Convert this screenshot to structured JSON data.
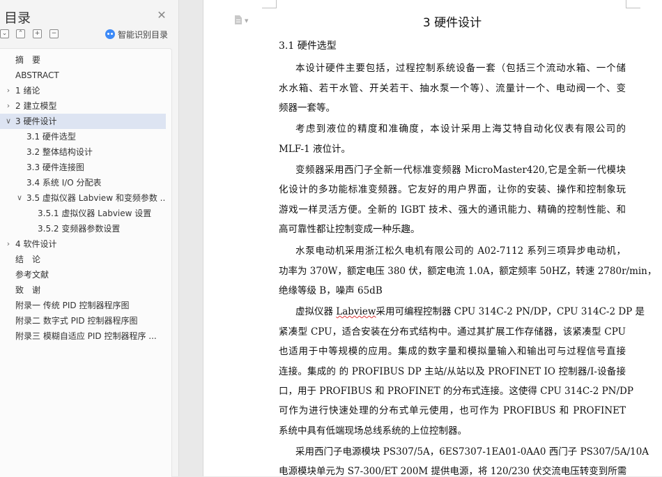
{
  "sidebar": {
    "title": "目录",
    "close_icon": "close-icon",
    "tools": [
      "collapse-all-icon",
      "expand-all-icon",
      "add-icon",
      "remove-icon"
    ],
    "smart_toc_label": "智能识别目录",
    "toc": [
      {
        "label": "摘　要",
        "caret": ""
      },
      {
        "label": "ABSTRACT",
        "caret": ""
      },
      {
        "label": "1 绪论",
        "caret": ">"
      },
      {
        "label": "2 建立模型",
        "caret": ">"
      },
      {
        "label": "3 硬件设计",
        "caret": "v"
      },
      {
        "label": "3.1 硬件选型",
        "caret": ""
      },
      {
        "label": "3.2 整体结构设计",
        "caret": ""
      },
      {
        "label": "3.3 硬件连接图",
        "caret": ""
      },
      {
        "label": "3.4 系统 I/O 分配表",
        "caret": ""
      },
      {
        "label": "3.5 虚拟仪器 Labview 和变频参数 ...",
        "caret": "v"
      },
      {
        "label": "3.5.1 虚拟仪器 Labview 设置",
        "caret": ""
      },
      {
        "label": "3.5.2 变频器参数设置",
        "caret": ""
      },
      {
        "label": "4 软件设计",
        "caret": ">"
      },
      {
        "label": "结　论",
        "caret": ""
      },
      {
        "label": "参考文献",
        "caret": ""
      },
      {
        "label": "致　谢",
        "caret": ""
      },
      {
        "label": "附录一  传统 PID 控制器程序图",
        "caret": ""
      },
      {
        "label": "附录二  数字式 PID 控制器程序图",
        "caret": ""
      },
      {
        "label": "附录三  模糊自适应 PID 控制器程序 ...",
        "caret": ""
      }
    ]
  },
  "document": {
    "chapter_title": "3 硬件设计",
    "section_title": "3.1 硬件选型",
    "lines": [
      "本设计硬件主要包括，过程控制系统设备一套（包括三个流动水箱、一个储",
      "水水箱、若干水管、开关若干、抽水泵一个等）、流量计一个、电动阀一个、变",
      "频器一套等。",
      "考虑到液位的精度和准确度，本设计采用上海艾特自动化仪表有限公司的",
      "MLF-1 液位计。",
      "变频器采用西门子全新一代标准变频器 MicroMaster420,它是全新一代模块",
      "化设计的多功能标准变频器。它友好的用户界面，让你的安装、操作和控制象玩",
      "游戏一样灵活方便。全新的 IGBT 技术、强大的通讯能力、精确的控制性能、和",
      "高可靠性都让控制变成一种乐趣。",
      "水泵电动机采用浙江松久电机有限公司的 A02-7112 系列三项异步电动机，",
      "功率为 370W，额定电压 380 伏，额定电流 1.0A，额定频率 50HZ，转速 2780r/min，",
      "绝缘等级 B，噪声 65dB",
      "虚拟仪器 Labview采用可编程控制器 CPU 314C-2 PN/DP，CPU 314C-2 DP 是",
      "紧凑型 CPU，适合安装在分布式结构中。通过其扩展工作存储器，该紧凑型 CPU",
      "也适用于中等规模的应用。集成的数字量和模拟量输入和输出可与过程信号直接",
      "连接。集成的 的 PROFIBUS DP 主站/从站以及 PROFINET IO 控制器/I-设备接",
      "口，用于 PROFIBUS 和 PROFINET 的分布式连接。这使得 CPU 314C-2 PN/DP",
      "可作为进行快速处理的分布式单元使用，也可作为 PROFIBUS 和 PROFINET",
      "系统中具有低端现场总线系统的上位控制器。",
      "采用西门子电源模块 PS307/5A，6ES7307-1EA01-0AA0 西门子 PS307/5A/10A",
      "电源模块单元为 S7-300/ET 200M 提供电源，将 120/230 伏交流电压转变到所需"
    ]
  }
}
